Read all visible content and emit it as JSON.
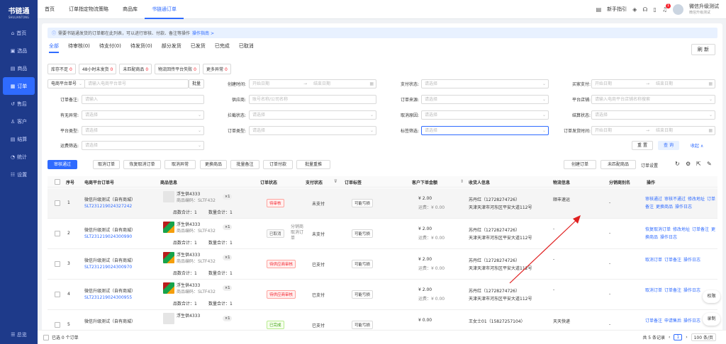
{
  "brand": {
    "title": "书链通",
    "subtitle": "SHULIANTONG"
  },
  "nav": [
    {
      "label": "首页",
      "icon": "home-icon"
    },
    {
      "label": "选品",
      "icon": "select-icon"
    },
    {
      "label": "商品",
      "icon": "goods-icon"
    },
    {
      "label": "订单",
      "icon": "order-icon"
    },
    {
      "label": "售后",
      "icon": "aftersale-icon"
    },
    {
      "label": "客户",
      "icon": "customer-icon"
    },
    {
      "label": "结算",
      "icon": "settle-icon"
    },
    {
      "label": "统计",
      "icon": "stats-icon"
    },
    {
      "label": "设置",
      "icon": "settings-icon"
    }
  ],
  "side_bottom": "☰ 总览",
  "topTabs": [
    "首页",
    "订单指定物流策略",
    "商品库",
    "书链通订单"
  ],
  "topRight": {
    "guide": "新手指引",
    "notify_count": "1",
    "user_name": "微信升级测试",
    "user_sub": "微信升级测试"
  },
  "notice": {
    "text": "需要书链通发货的订单都在此列表，可以进行审核、付款、备注等操作",
    "link": "操作指南 >"
  },
  "statusTabs": [
    "全部",
    "待审核(0)",
    "待支付(0)",
    "待发货(0)",
    "部分发货",
    "已发货",
    "已完成",
    "已取消"
  ],
  "refresh": "刷 新",
  "chips": [
    {
      "label": "库存不足",
      "count": "0"
    },
    {
      "label": "48小时未发货",
      "count": "0"
    },
    {
      "label": "未匹配商品",
      "count": "0"
    },
    {
      "label": "物流回传平台失败",
      "count": "0"
    },
    {
      "label": "更多异常",
      "count": "0"
    }
  ],
  "filters": {
    "platform_order": "电商平台单号",
    "platform_order_ph": "请输入电商平台单号",
    "batch": "批量",
    "created_time": "创建时间:",
    "start": "开始日期",
    "end": "结束日期",
    "pay_status": "支付状态:",
    "buyer_pay": "买家支付:",
    "select_ph": "请选择",
    "order_remark": "订单备注:",
    "input_ph": "请输入",
    "supplier": "供应商:",
    "supplier_ph": "账号名称/公司名称",
    "order_source": "订单来源:",
    "shop": "平台店铺:",
    "shop_ph": "请输入电商平台店铺名称搜索",
    "has_exception": "有无异常:",
    "intercept": "拦截状态:",
    "cancel_reason": "取消原因:",
    "settle_status": "结算状态:",
    "platform_type": "平台类型:",
    "order_type": "订单类型:",
    "tag_filter": "标签筛选:",
    "ship_time": "订单发货时间:",
    "ship_filter": "运费筛选:",
    "reset": "重 置",
    "query": "查 询",
    "collapse": "收起 ∧"
  },
  "actions": [
    "审核通过",
    "取消订单",
    "恢复取消订单",
    "取消异常",
    "更换商品",
    "批量备注",
    "订单付款",
    "批量重推"
  ],
  "right_actions": {
    "create": "创建订单",
    "match": "未匹配商品",
    "settings": "订单设置"
  },
  "columns": {
    "no": "序号",
    "order": "电商平台订单号",
    "goods": "商品信息",
    "status": "订单状态",
    "pay": "支付状态",
    "tag": "订单标签",
    "amount": "客户下单金额",
    "receiver": "收货人信息",
    "logistics": "物流信息",
    "distributor": "分销商别名",
    "op": "操作"
  },
  "rows": [
    {
      "no": "1",
      "shop": "微信升级测试（自有商城）",
      "order": "SLT231219024327242",
      "pimg": "grey",
      "pname": "浮生供4333",
      "pcode": "商品编码：SLTF432",
      "qty": "×1",
      "goods_total": "品数合计：1",
      "qty_total": "数量合计：1",
      "status": "待审核",
      "status_style": "red",
      "status_note": "",
      "pay": "未支付",
      "tag": "可能亏损",
      "amount": "¥ 2.00",
      "freight": "运费：¥ 0.00",
      "rname": "苏丹红（12728274726）",
      "raddr": "天津天津市河东区平安大道112号",
      "logistics": "顺丰速运",
      "dist": "-",
      "ops": [
        "审核通过",
        "审核不通过",
        "修改地址",
        "订单备注",
        "更换商品",
        "操作日志"
      ]
    },
    {
      "no": "2",
      "shop": "微信升级测试（自有商城）",
      "order": "SLT231219024300990",
      "pimg": "color",
      "pname": "浮生供4333",
      "pcode": "商品编码：SLTF432",
      "qty": "×1",
      "goods_total": "品数合计：1",
      "qty_total": "数量合计：1",
      "status": "已取消",
      "status_style": "grey",
      "status_note": "分销商取消订单",
      "pay": "未支付",
      "tag": "可能亏损",
      "amount": "¥ 2.00",
      "freight": "运费：¥ 0.00",
      "rname": "苏丹红（12728274726）",
      "raddr": "天津天津市河东区平安大道112号",
      "logistics": "-",
      "dist": "-",
      "ops": [
        "恢复取消订单",
        "修改地址",
        "订单备注",
        "更换商品",
        "操作日志"
      ]
    },
    {
      "no": "3",
      "shop": "微信升级测试（自有商城）",
      "order": "SLT231219024300970",
      "pimg": "color",
      "pname": "浮生供4333",
      "pcode": "商品编码：SLTF432",
      "qty": "×1",
      "goods_total": "品数合计：1",
      "qty_total": "数量合计：1",
      "status": "待供应商审核",
      "status_style": "red",
      "status_note": "",
      "pay": "已支付",
      "tag": "可能亏损",
      "amount": "¥ 2.00",
      "freight": "运费：¥ 0.00",
      "rname": "苏丹红（12728274726）",
      "raddr": "天津天津市河东区平安大道112号",
      "logistics": "-",
      "dist": "-",
      "ops": [
        "取消订单",
        "订单备注",
        "操作日志"
      ]
    },
    {
      "no": "4",
      "shop": "微信升级测试（自有商城）",
      "order": "SLT231219024300955",
      "pimg": "color",
      "pname": "浮生供4333",
      "pcode": "商品编码：SLTF432",
      "qty": "×1",
      "goods_total": "品数合计：1",
      "qty_total": "数量合计：1",
      "status": "待供应商审核",
      "status_style": "red",
      "status_note": "",
      "pay": "已支付",
      "tag": "可能亏损",
      "amount": "¥ 2.00",
      "freight": "运费：¥ 0.00",
      "rname": "苏丹红（12728274726）",
      "raddr": "天津天津市河东区平安大道112号",
      "logistics": "-",
      "dist": "-",
      "ops": [
        "取消订单",
        "订单备注",
        "操作日志"
      ]
    },
    {
      "no": "5",
      "shop": "微信升级测试（自有商城）",
      "order": "",
      "pimg": "grey",
      "pname": "浮生供4333",
      "pcode": "",
      "qty": "×1",
      "goods_total": "",
      "qty_total": "",
      "status": "已完成",
      "status_style": "green",
      "status_note": "",
      "pay": "已支付",
      "tag": "可能亏损",
      "amount": "¥ 0.00",
      "freight": "",
      "rname": "王女士01（15827257104）",
      "raddr": "",
      "logistics": "天天快递",
      "dist": "-",
      "ops": [
        "订单备注",
        "申请售后",
        "操作日志"
      ]
    }
  ],
  "footer": {
    "selected": "已选 0 个订单",
    "total": "共 5 条记录",
    "page": "1",
    "page_size": "100 条/页"
  },
  "floats": {
    "perm": "权限",
    "record": "录制"
  },
  "colors": {
    "primary": "#2f6bff",
    "sidebar": "#1e3a8a",
    "danger": "#f5222d"
  }
}
